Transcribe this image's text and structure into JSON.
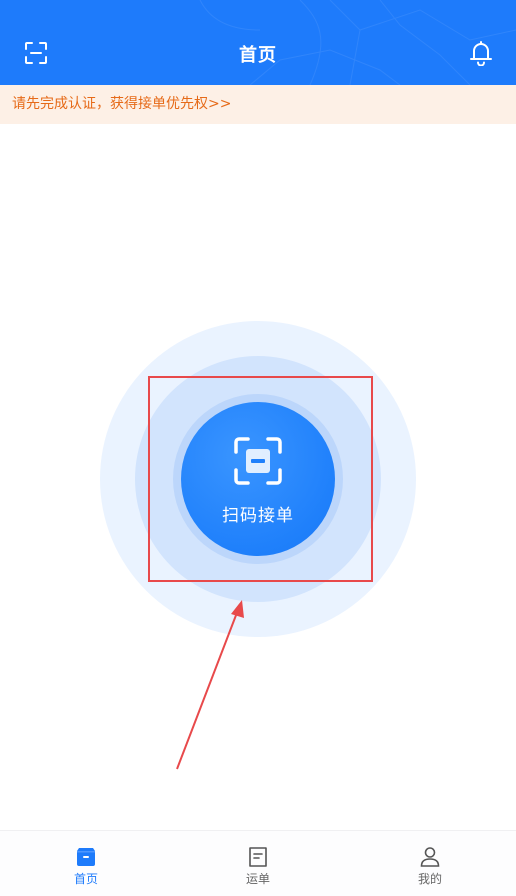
{
  "header": {
    "title": "首页",
    "left_icon": "scan-icon",
    "right_icon": "bell-icon",
    "background": "#1e7bfb"
  },
  "notice": {
    "text": "请先完成认证，获得接单优先权>>",
    "text_color": "#e66a18",
    "background": "#fdf0e6"
  },
  "scan": {
    "label": "扫码接单",
    "icon": "scan-icon",
    "color": "#1f80fb"
  },
  "annotation": {
    "highlight_color": "#e8494b"
  },
  "tabbar": {
    "tabs": [
      {
        "label": "首页",
        "icon": "home-box-icon",
        "active": true
      },
      {
        "label": "运单",
        "icon": "document-icon",
        "active": false
      },
      {
        "label": "我的",
        "icon": "user-icon",
        "active": false
      }
    ],
    "active_color": "#1e7bfb"
  }
}
